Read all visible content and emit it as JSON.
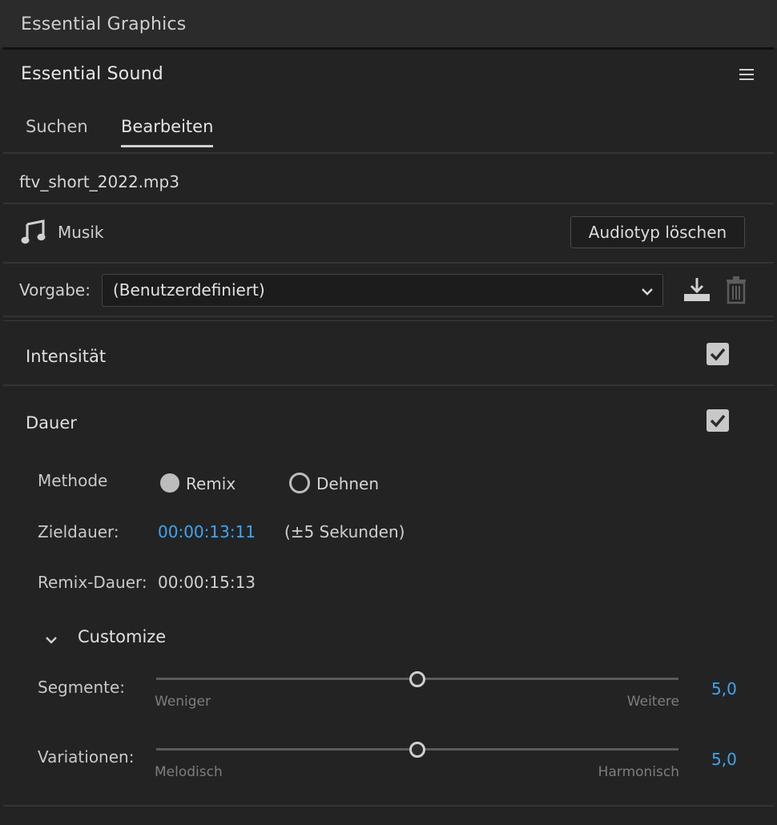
{
  "panels": {
    "upper_title": "Essential Graphics",
    "main_title": "Essential Sound"
  },
  "tabs": [
    {
      "label": "Suchen",
      "active": false
    },
    {
      "label": "Bearbeiten",
      "active": true
    }
  ],
  "clip": {
    "filename": "ftv_short_2022.mp3",
    "audio_type": "Musik",
    "clear_button": "Audiotyp löschen"
  },
  "preset": {
    "label": "Vorgabe:",
    "selected": "(Benutzerdefiniert)"
  },
  "sections": {
    "intensity": {
      "title": "Intensität",
      "checked": true
    },
    "duration": {
      "title": "Dauer",
      "checked": true
    }
  },
  "duration": {
    "method_label": "Methode",
    "options": [
      "Remix",
      "Dehnen"
    ],
    "selected_option": "Remix",
    "target_label": "Zieldauer:",
    "target_value": "00:00:13:11",
    "target_note": "(±5 Sekunden)",
    "remix_label": "Remix-Dauer:",
    "remix_value": "00:00:15:13"
  },
  "customize": {
    "title": "Customize",
    "sliders": [
      {
        "label": "Segmente:",
        "min_label": "Weniger",
        "max_label": "Weitere",
        "value": "5,0",
        "position": 0.5
      },
      {
        "label": "Variationen:",
        "min_label": "Melodisch",
        "max_label": "Harmonisch",
        "value": "5,0",
        "position": 0.5
      }
    ]
  },
  "colors": {
    "accent": "#3ea6ec",
    "background": "#232323"
  },
  "icons": {
    "music": "music-note-icon",
    "menu": "hamburger-menu-icon",
    "download": "download-preset-icon",
    "trash": "trash-icon",
    "dropdown": "chevron-down-icon",
    "collapse": "chevron-down-icon"
  }
}
